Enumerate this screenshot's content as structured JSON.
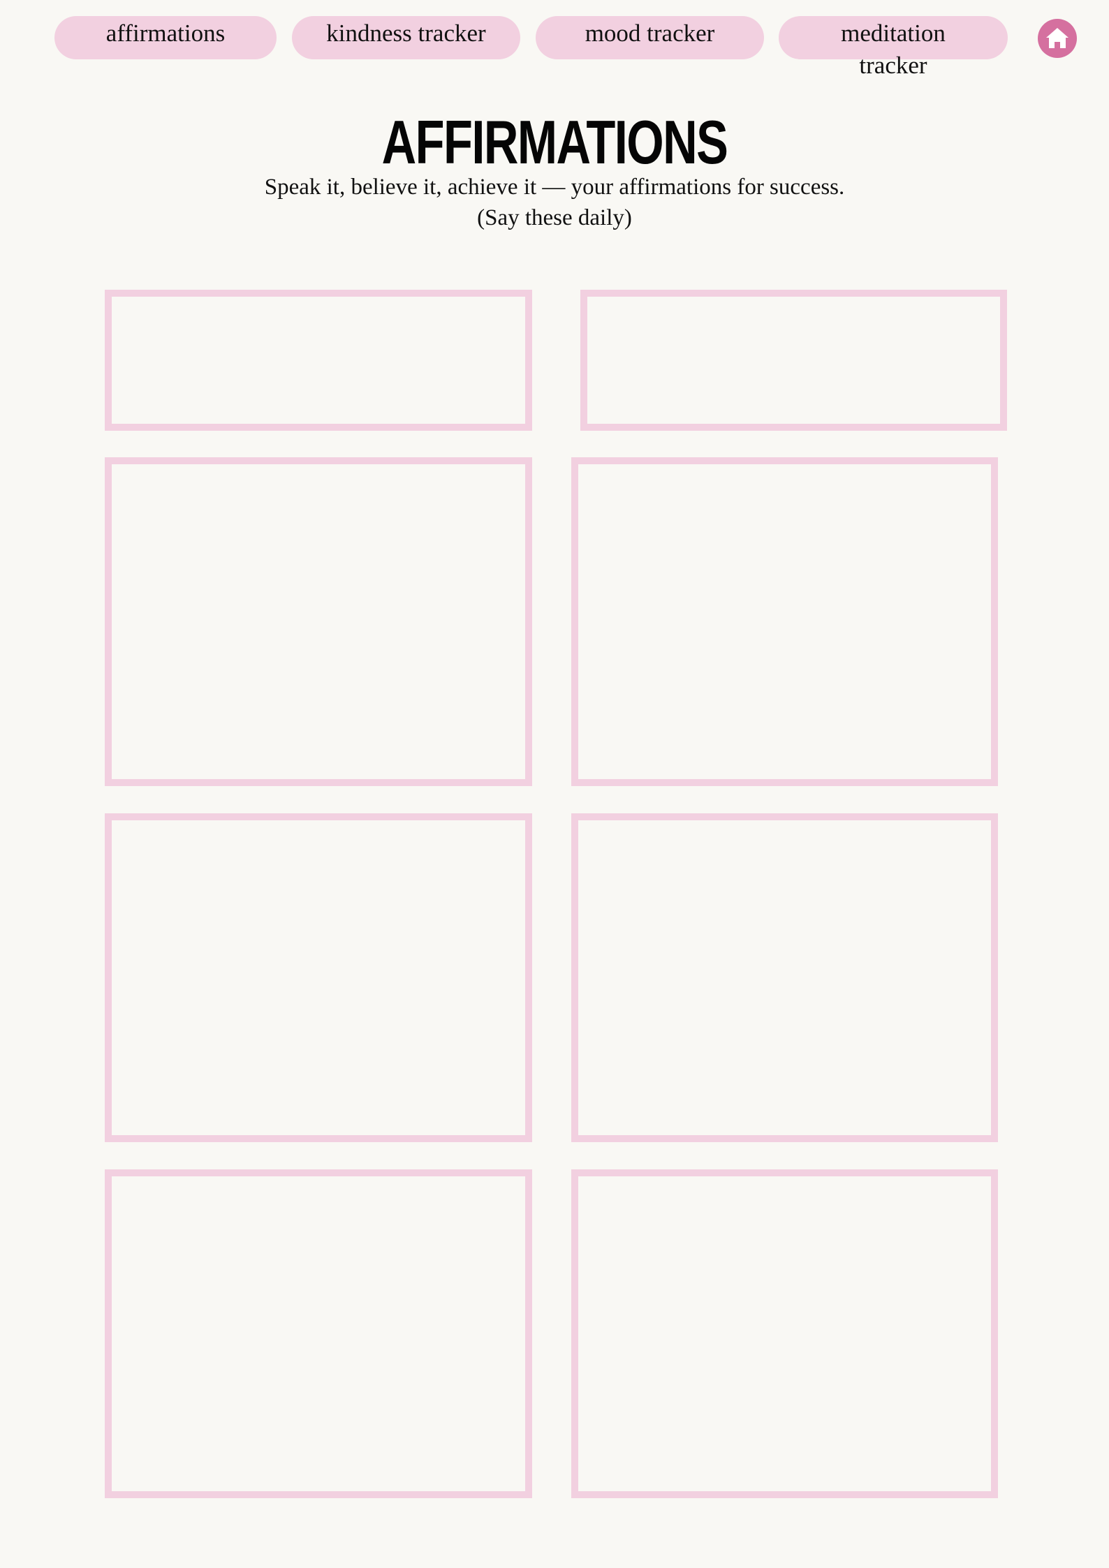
{
  "nav": {
    "tabs": [
      {
        "label": "affirmations"
      },
      {
        "label": "kindness tracker"
      },
      {
        "label": "mood tracker"
      },
      {
        "label": "meditation tracker"
      }
    ],
    "home_icon": "home-icon"
  },
  "header": {
    "title": "AFFIRMATIONS",
    "subtitle": "Speak it, believe it, achieve it — your affirmations for success.",
    "note": "(Say these daily)"
  },
  "colors": {
    "background": "#f9f8f4",
    "tab_fill": "#f2d0e0",
    "box_border": "#f2d0e0",
    "home_accent": "#d5709f",
    "text": "#111111"
  }
}
